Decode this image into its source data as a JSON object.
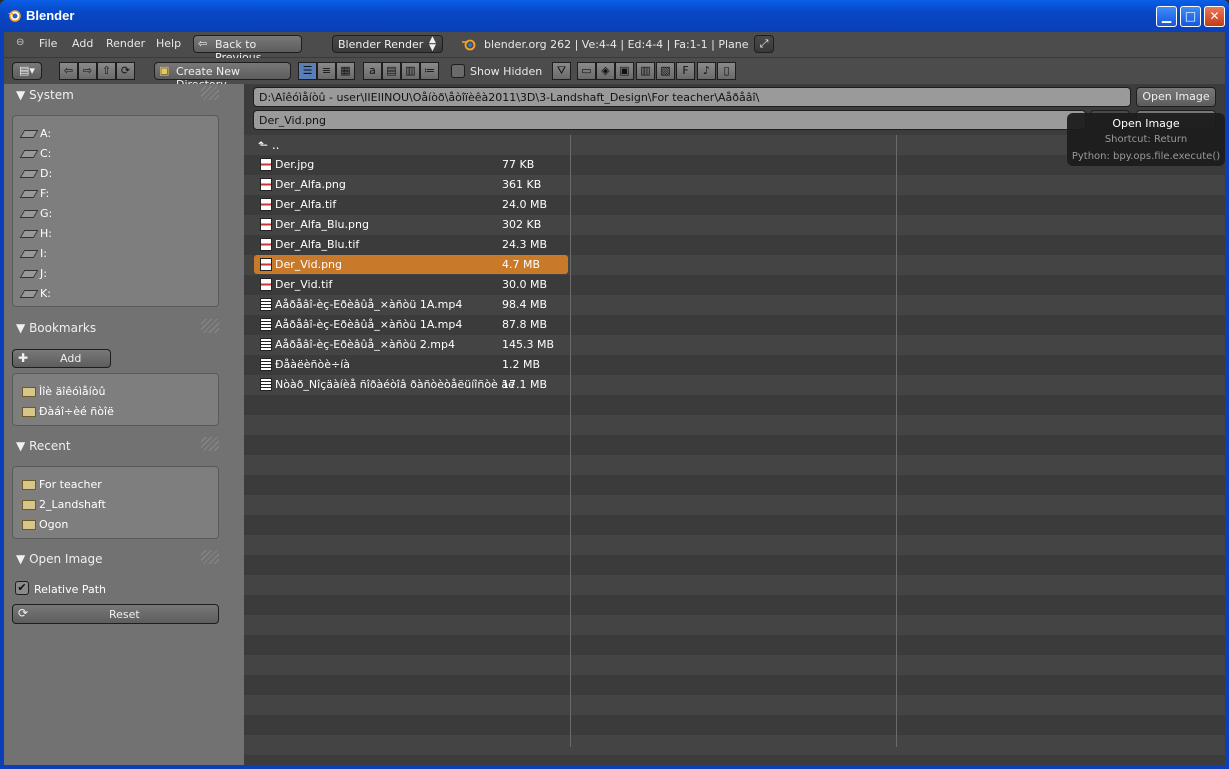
{
  "window": {
    "title": "Blender"
  },
  "infobar": {
    "menus": [
      "File",
      "Add",
      "Render",
      "Help"
    ],
    "back_button": "Back to Previous",
    "render_engine": "Blender Render",
    "stats": "blender.org 262 | Ve:4-4 | Ed:4-4 | Fa:1-1 | Plane"
  },
  "toolbar": {
    "create_dir_label": "Create New Directory",
    "show_hidden_label": "Show Hidden"
  },
  "sidebar": {
    "system": {
      "title": "System",
      "drives": [
        "A:",
        "C:",
        "D:",
        "F:",
        "G:",
        "H:",
        "I:",
        "J:",
        "K:"
      ]
    },
    "bookmarks": {
      "title": "Bookmarks",
      "add_label": "Add",
      "items": [
        "Ìîè äîêóìåíòû",
        "Ðàáî÷èé ñòîë"
      ]
    },
    "recent": {
      "title": "Recent",
      "items": [
        "For teacher",
        "2_Landshaft",
        "Ogon"
      ]
    },
    "operator": {
      "title": "Open Image",
      "relative_path_label": "Relative Path",
      "relative_path_checked": true,
      "reset_label": "Reset"
    }
  },
  "browser": {
    "directory": "D:\\Aîêóìåíòû - user\\IIEIINOU\\Oåíòð\\åòîïèêà2011\\3D\\3-Landshaft_Design\\For teacher\\Aåðåâî\\",
    "filename": "Der_Vid.png",
    "open_button": "Open Image",
    "parent_label": "..",
    "files": [
      {
        "name": "Der.jpg",
        "size": "77 KB",
        "kind": "image"
      },
      {
        "name": "Der_Alfa.png",
        "size": "361 KB",
        "kind": "image"
      },
      {
        "name": "Der_Alfa.tif",
        "size": "24.0 MB",
        "kind": "image"
      },
      {
        "name": "Der_Alfa_Blu.png",
        "size": "302 KB",
        "kind": "image"
      },
      {
        "name": "Der_Alfa_Blu.tif",
        "size": "24.3 MB",
        "kind": "image"
      },
      {
        "name": "Der_Vid.png",
        "size": "4.7 MB",
        "kind": "image",
        "selected": true
      },
      {
        "name": "Der_Vid.tif",
        "size": "30.0 MB",
        "kind": "image"
      },
      {
        "name": "Aåðåâî-èç-Eðèâûå_×àñòü 1A.mp4",
        "size": "98.4 MB",
        "kind": "movie"
      },
      {
        "name": "Aåðåâî-èç-Eðèâûå_×àñòü 1A.mp4",
        "size": "87.8 MB",
        "kind": "movie"
      },
      {
        "name": "Aåðåâî-èç-Eðèâûå_×àñòü 2.mp4",
        "size": "145.3 MB",
        "kind": "movie"
      },
      {
        "name": "Ðåàëèñòè÷íà",
        "size": "1.2 MB",
        "kind": "movie"
      },
      {
        "name": "Nòàð_Nîçäàíèå ñîðàéòîâ ðàñòèòåëüíîñòè äë",
        "size": "17.1 MB",
        "kind": "movie"
      }
    ]
  },
  "tooltip": {
    "title": "Open Image",
    "shortcut": "Shortcut: Return",
    "python": "Python: bpy.ops.file.execute()"
  },
  "colors": {
    "selection": "#c87a2a",
    "titlebar": "#0a4fd8"
  }
}
